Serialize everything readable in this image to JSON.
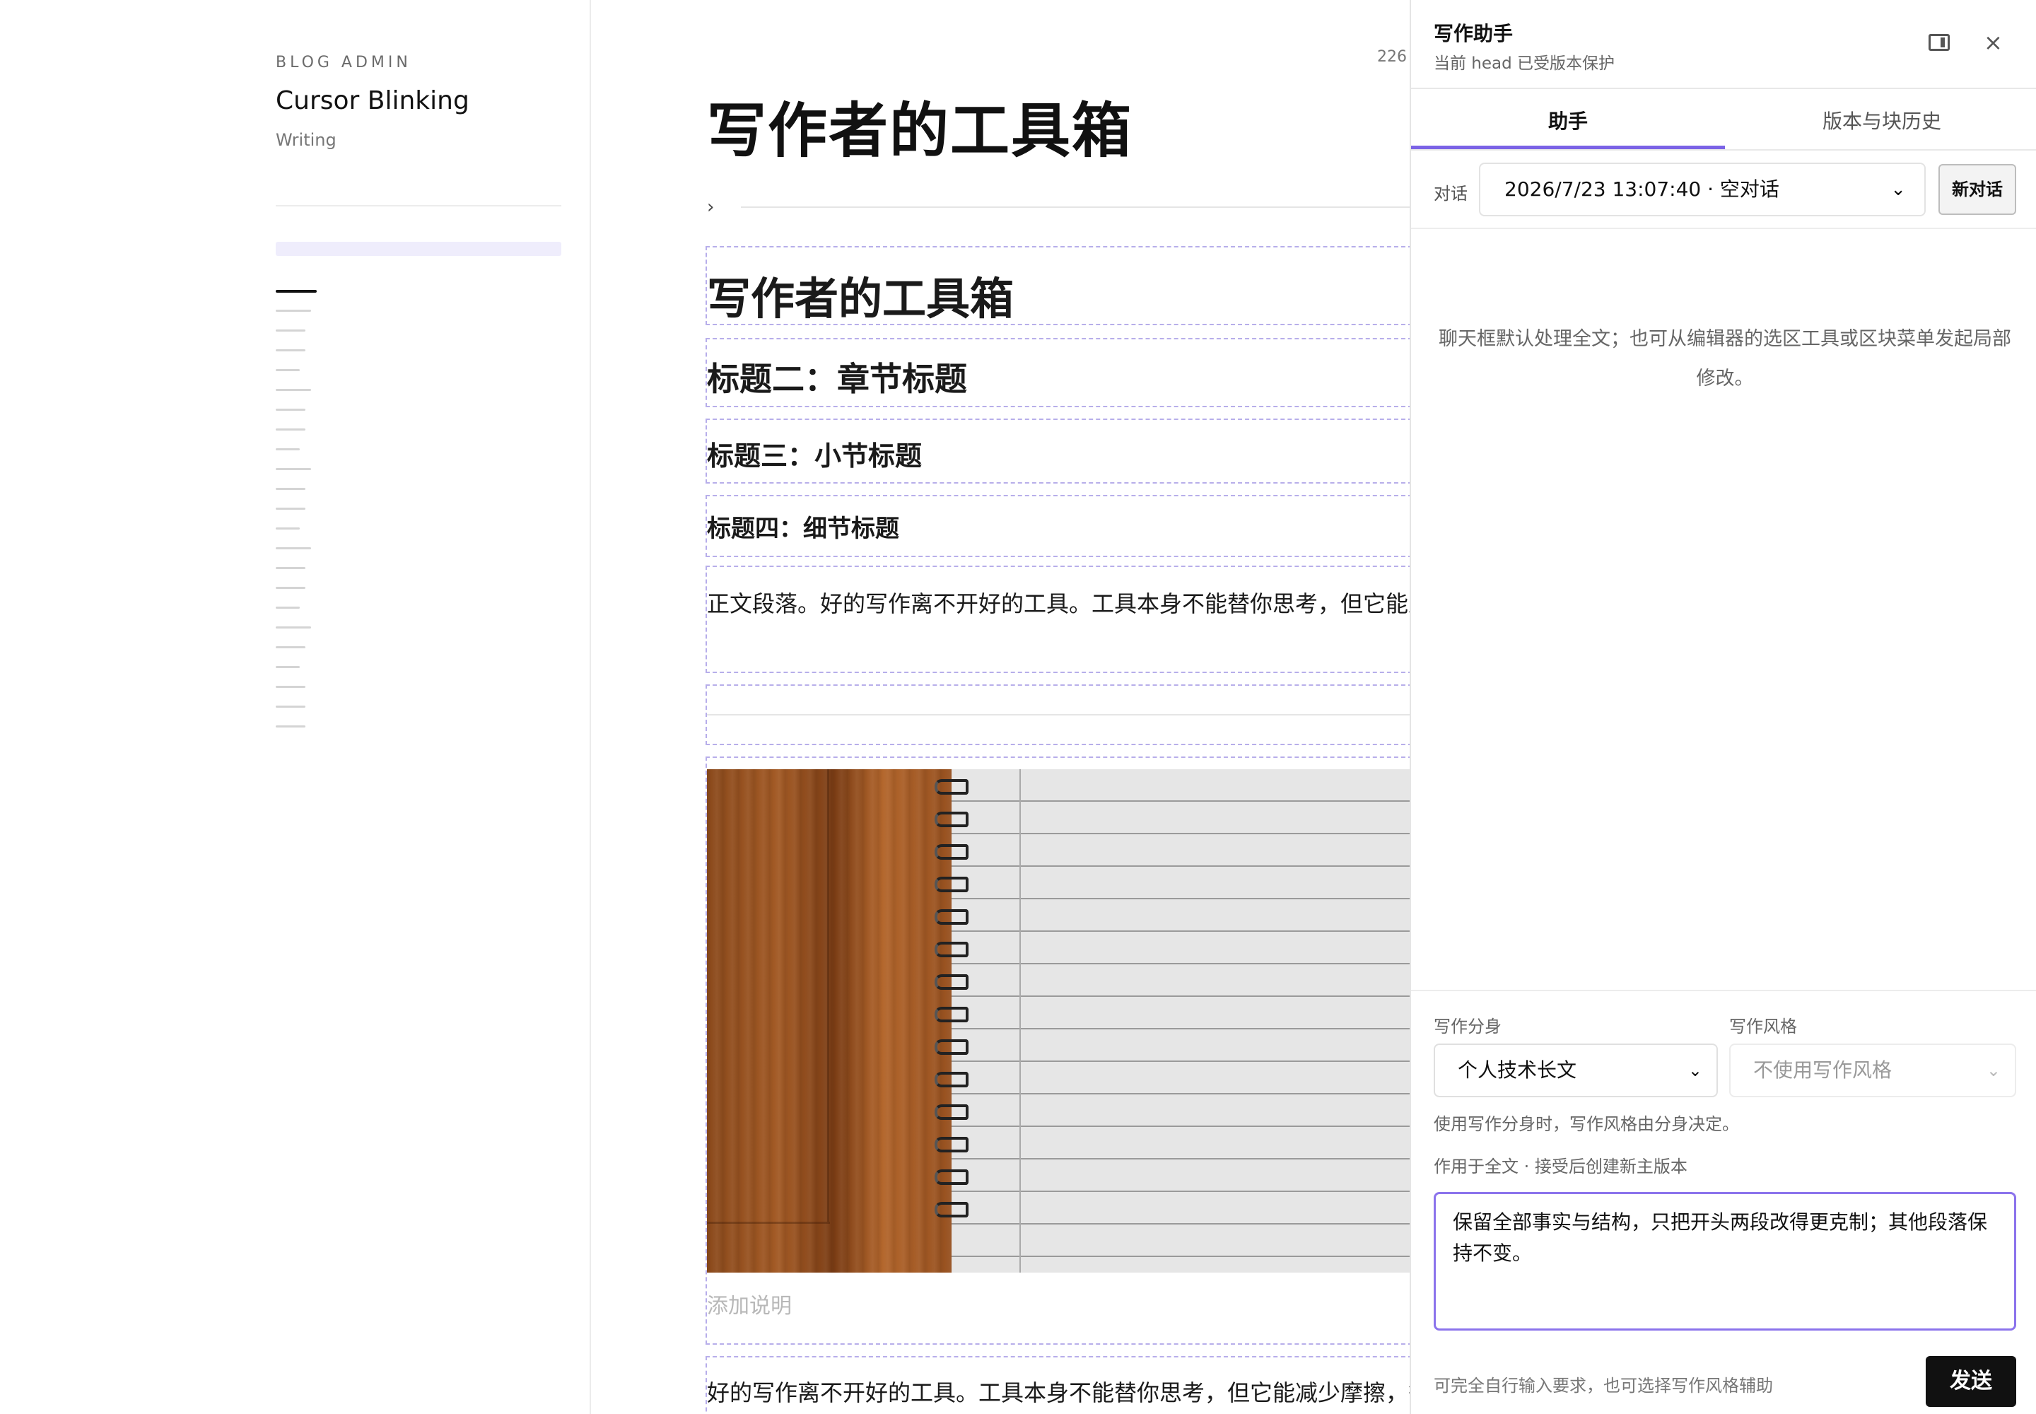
{
  "sidebar": {
    "eyebrow": "BLOG ADMIN",
    "title": "Cursor Blinking",
    "section": "Writing",
    "outline_line_count": 23
  },
  "editor": {
    "word_count": "226",
    "page_title": "写作者的工具箱",
    "outline_toggle_icon": "chevron-right-icon",
    "blocks": {
      "h1": "写作者的工具箱",
      "h2": "标题二：章节标题",
      "h3": "标题三：小节标题",
      "h4": "标题四：细节标题",
      "paragraph": "正文段落。好的写作离不开好的工具。工具本身不能替你思考，但它能上。",
      "image_caption_placeholder": "添加说明",
      "paragraph2": "好的写作离不开好的工具。工具本身不能替你思考，但它能减少摩擦，等、数字工具、自动化、工作流四个维度，梳理一套实用的写作者工具"
    }
  },
  "assistant": {
    "title": "写作助手",
    "subtitle": "当前 head 已受版本保护",
    "icons": {
      "toggle_panel": "sidebar-toggle-icon",
      "close": "close-icon"
    },
    "close_glyph": "×",
    "tabs": [
      {
        "label": "助手",
        "active": true
      },
      {
        "label": "版本与块历史",
        "active": false
      }
    ],
    "conversation": {
      "label": "对话",
      "selected": "2026/7/23 13:07:40 · 空对话",
      "new_button": "新对话"
    },
    "empty_hint": "聊天框默认处理全文；也可从编辑器的选区工具或区块菜单发起局部修改。",
    "persona": {
      "label": "写作分身",
      "selected": "个人技术长文"
    },
    "style": {
      "label": "写作风格",
      "selected": "不使用写作风格"
    },
    "persona_note": "使用写作分身时，写作风格由分身决定。",
    "scope_note": "作用于全文 · 接受后创建新主版本",
    "prompt_value": "保留全部事实与结构，只把开头两段改得更克制；其他段落保持不变。",
    "footer_note": "可完全自行输入要求，也可选择写作风格辅助",
    "send_label": "发送"
  },
  "colors": {
    "accent": "#7b63e6",
    "block_dash": "#b7aeea",
    "active_nav": "#efedfc",
    "send_button": "#111111"
  }
}
